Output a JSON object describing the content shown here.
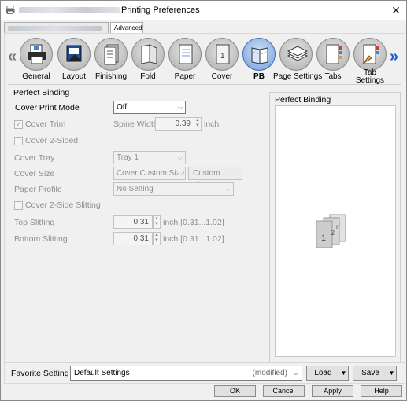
{
  "window": {
    "title": "Printing Preferences",
    "close_glyph": "✕"
  },
  "tabs": [
    {
      "label": ""
    },
    {
      "label": "Advanced"
    }
  ],
  "ribbon": {
    "left_arrow": "«",
    "right_arrow": "»",
    "items": [
      {
        "label": "General",
        "icon": "printer-icon"
      },
      {
        "label": "Layout",
        "icon": "layout-icon"
      },
      {
        "label": "Finishing",
        "icon": "finishing-icon"
      },
      {
        "label": "Fold",
        "icon": "fold-icon"
      },
      {
        "label": "Paper",
        "icon": "paper-icon"
      },
      {
        "label": "Cover",
        "icon": "cover-icon"
      },
      {
        "label": "PB",
        "icon": "perfect-binding-icon"
      },
      {
        "label": "Page Settings",
        "icon": "page-settings-icon"
      },
      {
        "label": "Tabs",
        "icon": "tabs-icon"
      },
      {
        "label": "Tab Settings",
        "icon": "tab-settings-icon"
      }
    ],
    "active": "PB"
  },
  "form": {
    "group_title": "Perfect Binding",
    "cover_print_mode": {
      "label": "Cover Print Mode",
      "value": "Off"
    },
    "cover_trim": {
      "label": "Cover Trim",
      "checked": true
    },
    "spine_width": {
      "label": "Spine Width",
      "value": "0.39",
      "unit": "inch"
    },
    "cover_2_sided": {
      "label": "Cover 2-Sided",
      "checked": false
    },
    "cover_tray": {
      "label": "Cover Tray",
      "value": "Tray 1"
    },
    "cover_size": {
      "label": "Cover Size",
      "value": "Cover Custom Size",
      "button": "Custom Size..."
    },
    "paper_profile": {
      "label": "Paper Profile",
      "value": "No Setting"
    },
    "cover_2_side_slitting": {
      "label": "Cover 2-Side Slitting",
      "checked": false
    },
    "top_slitting": {
      "label": "Top Slitting",
      "value": "0.31",
      "range": "inch [0.31...1.02]"
    },
    "bottom_slitting": {
      "label": "Bottom Slitting",
      "value": "0.31",
      "range": "inch [0.31...1.02]"
    }
  },
  "preview": {
    "title": "Perfect Binding",
    "page_labels": [
      "1",
      "2",
      "n"
    ]
  },
  "favorite": {
    "label": "Favorite Setting",
    "value": "Default Settings",
    "modified": "(modified)",
    "load": "Load",
    "save": "Save"
  },
  "buttons": {
    "ok": "OK",
    "cancel": "Cancel",
    "apply": "Apply",
    "help": "Help"
  }
}
